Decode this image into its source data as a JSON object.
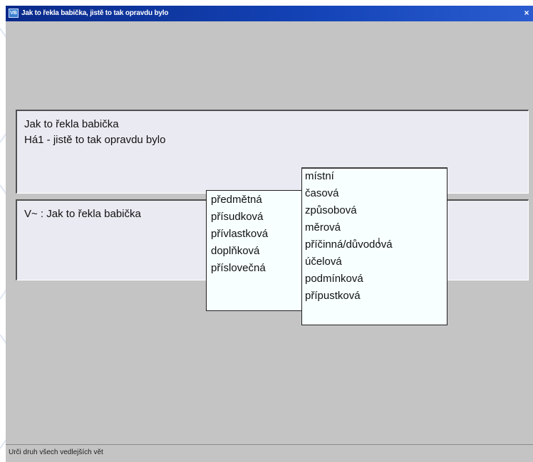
{
  "window": {
    "title": "Jak to řekla babička, jistě to tak opravdu bylo",
    "app_icon": "VB",
    "close_label": "×"
  },
  "panel1": {
    "line1": "Jak to řekla babička",
    "line2": "Há1 - jistě to tak opravdu bylo"
  },
  "panel2": {
    "line1": "V~ : Jak to řekla babička"
  },
  "list_left": {
    "items": [
      "předmětná",
      "přísudková",
      "přívlastková",
      "doplňková",
      "příslovečná"
    ]
  },
  "list_right": {
    "items": [
      "místní",
      "časová",
      "způsobová",
      "měrová",
      "příčinná/důvodová",
      "účelová",
      "podmínková",
      "přípustková"
    ]
  },
  "status": {
    "text": "Urči druh všech vedlejších vět"
  },
  "icons": {
    "app": "window-app-icon",
    "close": "close-icon",
    "cursor": "text-cursor-icon"
  }
}
